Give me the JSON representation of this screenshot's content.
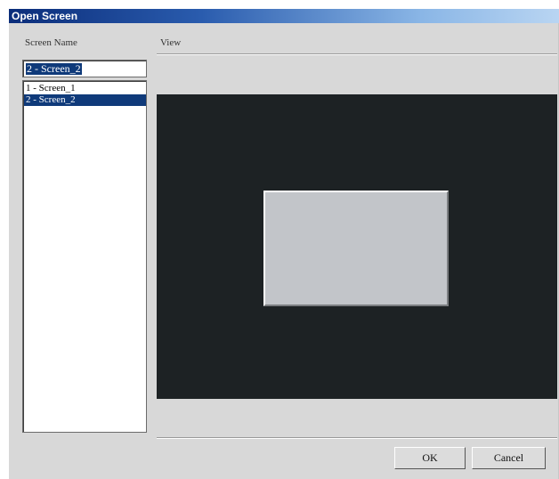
{
  "window": {
    "title": "Open Screen"
  },
  "labels": {
    "screen_name": "Screen Name",
    "view": "View"
  },
  "name_input": {
    "value": "2 - Screen_2"
  },
  "screen_list": {
    "items": [
      {
        "label": "1 - Screen_1",
        "selected": false
      },
      {
        "label": "2 - Screen_2",
        "selected": true
      }
    ]
  },
  "buttons": {
    "ok": "OK",
    "cancel": "Cancel"
  },
  "colors": {
    "title_bar_start": "#0b2d7a",
    "selection": "#0f3a7a",
    "preview_background": "#1d2224",
    "preview_screen": "#c2c5c9"
  }
}
